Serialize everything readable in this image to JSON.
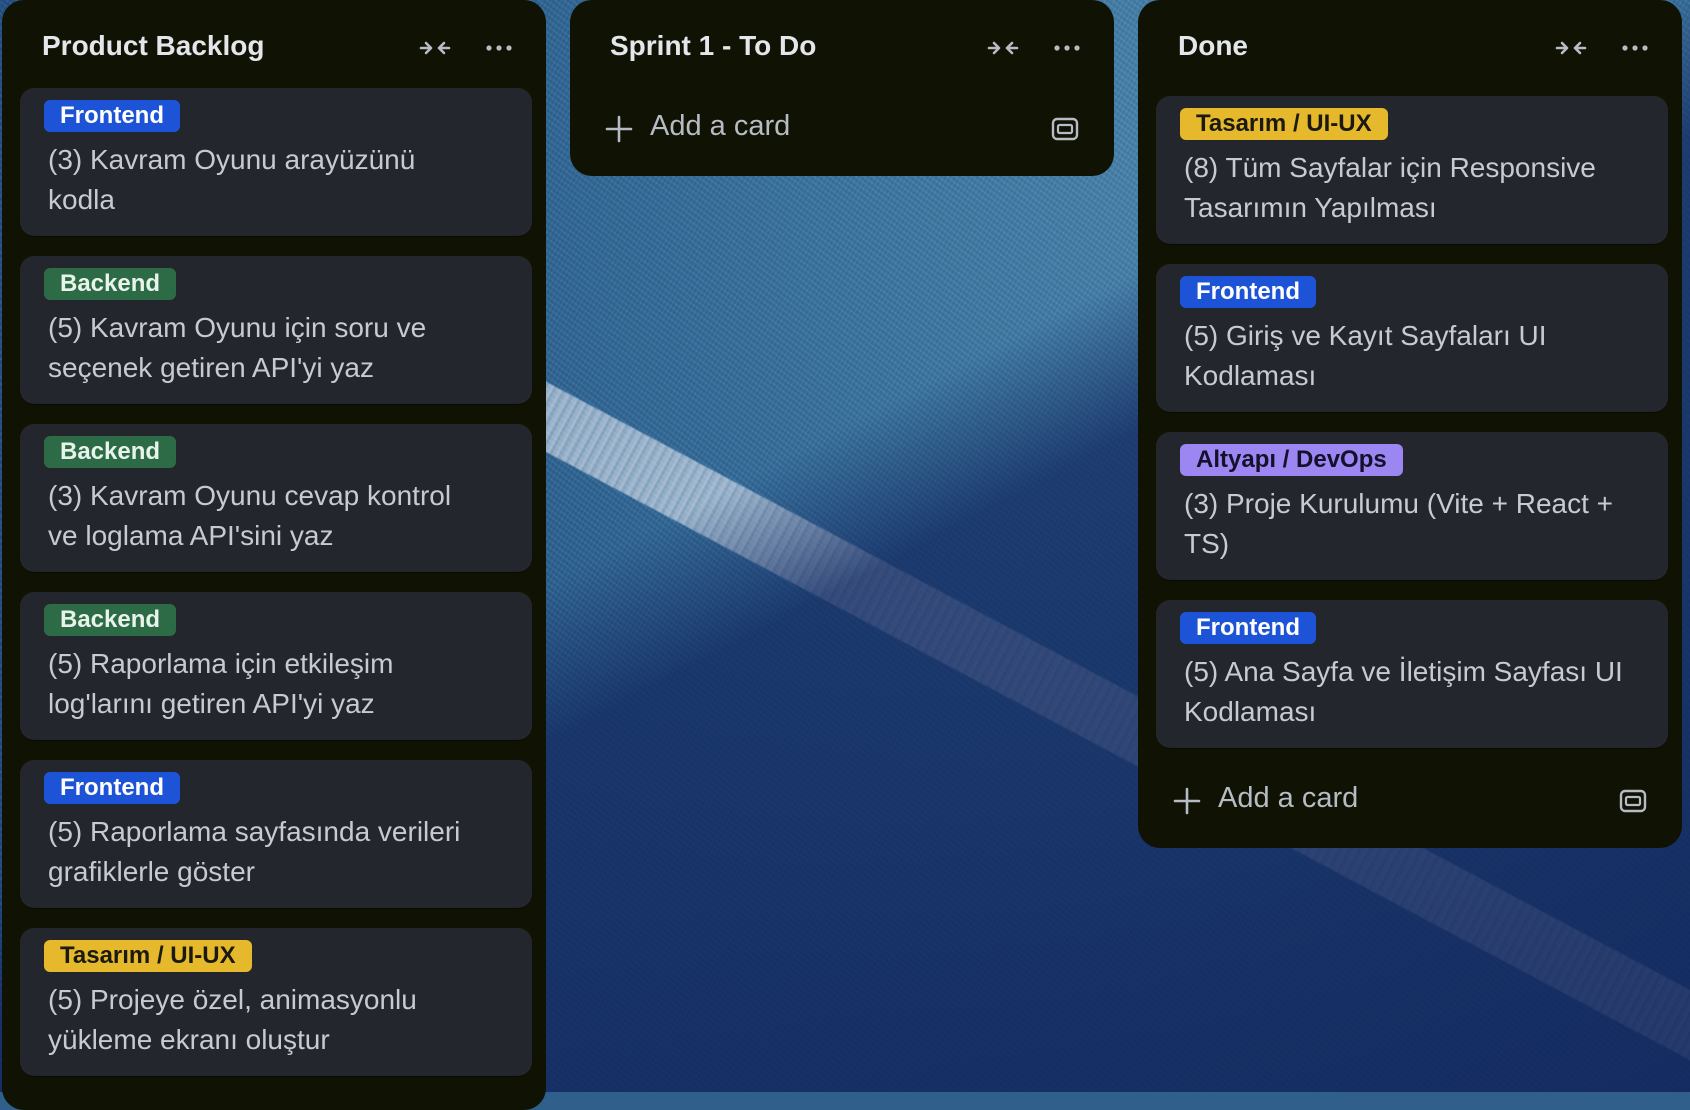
{
  "colors": {
    "list_bg": "#101204",
    "card_bg": "#23262c",
    "text": "#c7cbd1",
    "label_frontend": "#1d53d6",
    "label_backend": "#2c6b45",
    "label_design": "#e6b82c",
    "label_devops": "#9c86f2"
  },
  "lists": [
    {
      "title": "Product Backlog",
      "cards": [
        {
          "label": "Frontend",
          "label_type": "frontend",
          "text": "(3) Kavram Oyunu arayüzünü kodla"
        },
        {
          "label": "Backend",
          "label_type": "backend",
          "text": "(5) Kavram Oyunu için soru ve seçenek getiren API'yi yaz"
        },
        {
          "label": "Backend",
          "label_type": "backend",
          "text": "(3) Kavram Oyunu cevap kontrol ve loglama API'sini yaz"
        },
        {
          "label": "Backend",
          "label_type": "backend",
          "text": "(5) Raporlama için etkileşim log'larını getiren API'yi yaz"
        },
        {
          "label": "Frontend",
          "label_type": "frontend",
          "text": "(5) Raporlama sayfasında verileri grafiklerle göster"
        },
        {
          "label": "Tasarım / UI-UX",
          "label_type": "design",
          "text": "(5) Projeye özel, animasyonlu yükleme ekranı oluştur"
        }
      ]
    },
    {
      "title": "Sprint 1 - To Do",
      "add_card": "Add a card",
      "cards": []
    },
    {
      "title": "Done",
      "add_card": "Add a card",
      "cards": [
        {
          "label": "Tasarım / UI-UX",
          "label_type": "design",
          "text": "(8) Tüm Sayfalar için Responsive Tasarımın Yapılması"
        },
        {
          "label": "Frontend",
          "label_type": "frontend",
          "text": "(5) Giriş ve Kayıt Sayfaları UI Kodlaması"
        },
        {
          "label": "Altyapı / DevOps",
          "label_type": "devops",
          "text": "(3) Proje Kurulumu (Vite + React + TS)"
        },
        {
          "label": "Frontend",
          "label_type": "frontend",
          "text": "(5) Ana Sayfa ve İletişim Sayfası UI Kodlaması"
        }
      ]
    }
  ]
}
